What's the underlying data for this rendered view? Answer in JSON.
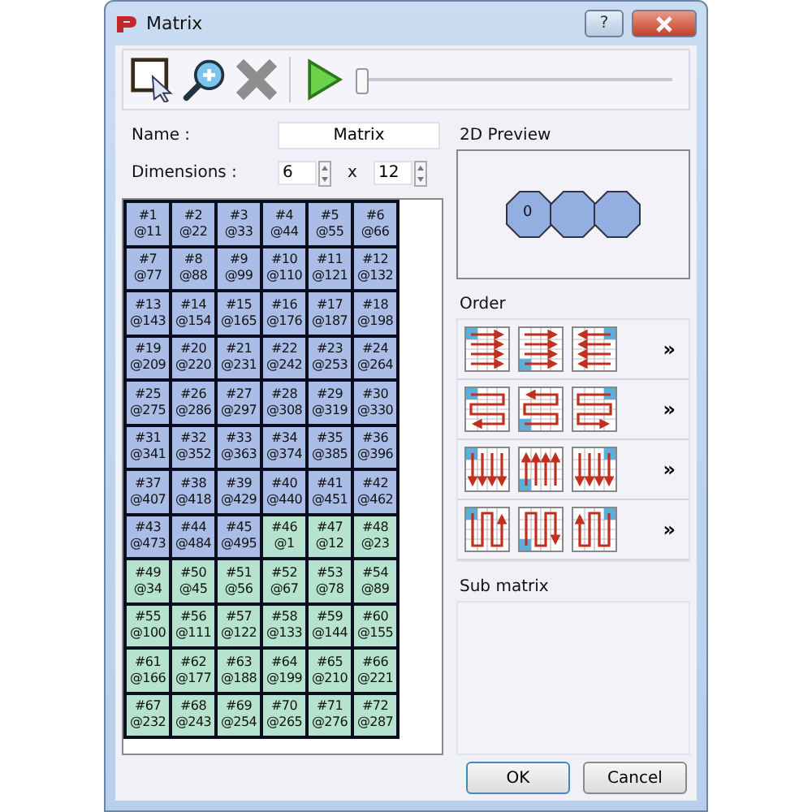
{
  "window": {
    "title": "Matrix",
    "help_button": "?"
  },
  "toolbar": {
    "slider": {
      "level": 0.0
    }
  },
  "form": {
    "name_label": "Name :",
    "name_value": "Matrix",
    "dimensions_label": "Dimensions :",
    "columns": "6",
    "times": "x",
    "rows": "12"
  },
  "matrix": {
    "rows": [
      [
        {
          "id": "#1",
          "address": "@11",
          "color": "#a9bde6"
        },
        {
          "id": "#2",
          "address": "@22",
          "color": "#a9bde6"
        },
        {
          "id": "#3",
          "address": "@33",
          "color": "#a9bde6"
        },
        {
          "id": "#4",
          "address": "@44",
          "color": "#a9bde6"
        },
        {
          "id": "#5",
          "address": "@55",
          "color": "#a9bde6"
        },
        {
          "id": "#6",
          "address": "@66",
          "color": "#a9bde6"
        }
      ],
      [
        {
          "id": "#7",
          "address": "@77",
          "color": "#a9bde6"
        },
        {
          "id": "#8",
          "address": "@88",
          "color": "#a9bde6"
        },
        {
          "id": "#9",
          "address": "@99",
          "color": "#a9bde6"
        },
        {
          "id": "#10",
          "address": "@110",
          "color": "#a9bde6"
        },
        {
          "id": "#11",
          "address": "@121",
          "color": "#a9bde6"
        },
        {
          "id": "#12",
          "address": "@132",
          "color": "#a9bde6"
        }
      ],
      [
        {
          "id": "#13",
          "address": "@143",
          "color": "#a9bde6"
        },
        {
          "id": "#14",
          "address": "@154",
          "color": "#a9bde6"
        },
        {
          "id": "#15",
          "address": "@165",
          "color": "#a9bde6"
        },
        {
          "id": "#16",
          "address": "@176",
          "color": "#a9bde6"
        },
        {
          "id": "#17",
          "address": "@187",
          "color": "#a9bde6"
        },
        {
          "id": "#18",
          "address": "@198",
          "color": "#a9bde6"
        }
      ],
      [
        {
          "id": "#19",
          "address": "@209",
          "color": "#a9bde6"
        },
        {
          "id": "#20",
          "address": "@220",
          "color": "#a9bde6"
        },
        {
          "id": "#21",
          "address": "@231",
          "color": "#a9bde6"
        },
        {
          "id": "#22",
          "address": "@242",
          "color": "#a9bde6"
        },
        {
          "id": "#23",
          "address": "@253",
          "color": "#a9bde6"
        },
        {
          "id": "#24",
          "address": "@264",
          "color": "#a9bde6"
        }
      ],
      [
        {
          "id": "#25",
          "address": "@275",
          "color": "#a9bde6"
        },
        {
          "id": "#26",
          "address": "@286",
          "color": "#a9bde6"
        },
        {
          "id": "#27",
          "address": "@297",
          "color": "#a9bde6"
        },
        {
          "id": "#28",
          "address": "@308",
          "color": "#a9bde6"
        },
        {
          "id": "#29",
          "address": "@319",
          "color": "#a9bde6"
        },
        {
          "id": "#30",
          "address": "@330",
          "color": "#a9bde6"
        }
      ],
      [
        {
          "id": "#31",
          "address": "@341",
          "color": "#a9bde6"
        },
        {
          "id": "#32",
          "address": "@352",
          "color": "#a9bde6"
        },
        {
          "id": "#33",
          "address": "@363",
          "color": "#a9bde6"
        },
        {
          "id": "#34",
          "address": "@374",
          "color": "#a9bde6"
        },
        {
          "id": "#35",
          "address": "@385",
          "color": "#a9bde6"
        },
        {
          "id": "#36",
          "address": "@396",
          "color": "#a9bde6"
        }
      ],
      [
        {
          "id": "#37",
          "address": "@407",
          "color": "#a9bde6"
        },
        {
          "id": "#38",
          "address": "@418",
          "color": "#a9bde6"
        },
        {
          "id": "#39",
          "address": "@429",
          "color": "#a9bde6"
        },
        {
          "id": "#40",
          "address": "@440",
          "color": "#a9bde6"
        },
        {
          "id": "#41",
          "address": "@451",
          "color": "#a9bde6"
        },
        {
          "id": "#42",
          "address": "@462",
          "color": "#a9bde6"
        }
      ],
      [
        {
          "id": "#43",
          "address": "@473",
          "color": "#a9bde6"
        },
        {
          "id": "#44",
          "address": "@484",
          "color": "#a9bde6"
        },
        {
          "id": "#45",
          "address": "@495",
          "color": "#a9bde6"
        },
        {
          "id": "#46",
          "address": "@1",
          "color": "#b5e3cf"
        },
        {
          "id": "#47",
          "address": "@12",
          "color": "#b5e3cf"
        },
        {
          "id": "#48",
          "address": "@23",
          "color": "#b5e3cf"
        }
      ],
      [
        {
          "id": "#49",
          "address": "@34",
          "color": "#b5e3cf"
        },
        {
          "id": "#50",
          "address": "@45",
          "color": "#b5e3cf"
        },
        {
          "id": "#51",
          "address": "@56",
          "color": "#b5e3cf"
        },
        {
          "id": "#52",
          "address": "@67",
          "color": "#b5e3cf"
        },
        {
          "id": "#53",
          "address": "@78",
          "color": "#b5e3cf"
        },
        {
          "id": "#54",
          "address": "@89",
          "color": "#b5e3cf"
        }
      ],
      [
        {
          "id": "#55",
          "address": "@100",
          "color": "#b5e3cf"
        },
        {
          "id": "#56",
          "address": "@111",
          "color": "#b5e3cf"
        },
        {
          "id": "#57",
          "address": "@122",
          "color": "#b5e3cf"
        },
        {
          "id": "#58",
          "address": "@133",
          "color": "#b5e3cf"
        },
        {
          "id": "#59",
          "address": "@144",
          "color": "#b5e3cf"
        },
        {
          "id": "#60",
          "address": "@155",
          "color": "#b5e3cf"
        }
      ],
      [
        {
          "id": "#61",
          "address": "@166",
          "color": "#b5e3cf"
        },
        {
          "id": "#62",
          "address": "@177",
          "color": "#b5e3cf"
        },
        {
          "id": "#63",
          "address": "@188",
          "color": "#b5e3cf"
        },
        {
          "id": "#64",
          "address": "@199",
          "color": "#b5e3cf"
        },
        {
          "id": "#65",
          "address": "@210",
          "color": "#b5e3cf"
        },
        {
          "id": "#66",
          "address": "@221",
          "color": "#b5e3cf"
        }
      ],
      [
        {
          "id": "#67",
          "address": "@232",
          "color": "#b5e3cf"
        },
        {
          "id": "#68",
          "address": "@243",
          "color": "#b5e3cf"
        },
        {
          "id": "#69",
          "address": "@254",
          "color": "#b5e3cf"
        },
        {
          "id": "#70",
          "address": "@265",
          "color": "#b5e3cf"
        },
        {
          "id": "#71",
          "address": "@276",
          "color": "#b5e3cf"
        },
        {
          "id": "#72",
          "address": "@287",
          "color": "#b5e3cf"
        }
      ]
    ]
  },
  "preview": {
    "title": "2D Preview",
    "first_label": "0"
  },
  "order": {
    "title": "Order",
    "rows": [
      {
        "kind": "rows",
        "more": "»"
      },
      {
        "kind": "snake-rows",
        "more": "»"
      },
      {
        "kind": "columns",
        "more": "»"
      },
      {
        "kind": "snake-columns",
        "more": "»"
      }
    ]
  },
  "sub_matrix": {
    "title": "Sub matrix"
  },
  "buttons": [
    "OK",
    "Cancel"
  ]
}
